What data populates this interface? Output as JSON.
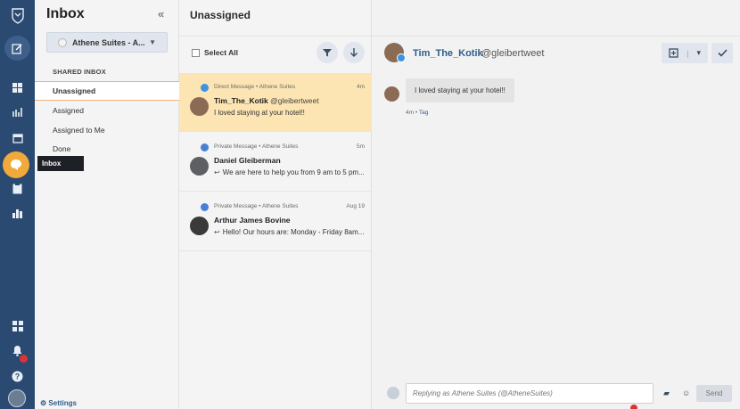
{
  "sidebar": {
    "title": "Inbox",
    "collapse_glyph": "«",
    "account_select": {
      "value": "Athene Suites - A..."
    },
    "section_heading": "SHARED INBOX",
    "items": [
      {
        "label": "Unassigned"
      },
      {
        "label": "Assigned"
      },
      {
        "label": "Assigned to Me"
      },
      {
        "label": "Done"
      }
    ],
    "tooltip": "Inbox",
    "settings_label": "Settings"
  },
  "list": {
    "title": "Unassigned",
    "select_all_label": "Select All",
    "messages": [
      {
        "meta": "Direct Message  •  Athene Suites",
        "time": "4m",
        "name": "Tim_The_Kotik",
        "handle": "@gleibertweet",
        "preview": "I loved staying at your hotel!!",
        "icon_color": "#3d93e0",
        "avatar_color": "#8c6b55"
      },
      {
        "meta": "Private Message  •  Athene Suites",
        "time": "5m",
        "name": "Daniel Gleiberman",
        "handle": "",
        "preview": "We are here to help you from 9 am to 5 pm...",
        "icon_color": "#4a7fd6",
        "avatar_color": "#5d5f63"
      },
      {
        "meta": "Private Message  •  Athene Suites",
        "time": "Aug 19",
        "name": "Arthur James Bovine",
        "handle": "",
        "preview": "Hello! Our hours are: Monday - Friday 8am...",
        "icon_color": "#4a7fd6",
        "avatar_color": "#3a3a3a"
      }
    ]
  },
  "conversation": {
    "name": "Tim_The_Kotik",
    "handle": "@gleibertweet",
    "message_text": "I loved staying at your hotel!!",
    "message_time": "4m",
    "tag_label": "Tag",
    "meta_separator": "•",
    "reply_placeholder": "Replying as Athene Suites (@AtheneSuites)",
    "send_label": "Send"
  },
  "colors": {
    "rail": "#2b4a72",
    "active_item": "#fde4b3",
    "accent": "#2e5d8c",
    "highlight": "#f0a93a"
  }
}
